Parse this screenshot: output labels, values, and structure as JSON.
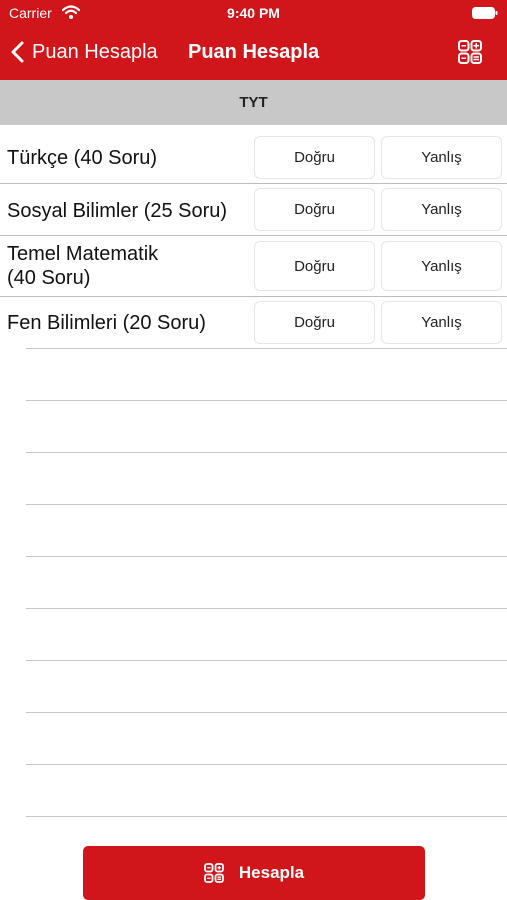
{
  "status_bar": {
    "carrier": "Carrier",
    "time": "9:40 PM",
    "wifi_icon": "wifi-icon",
    "battery_icon": "battery-icon"
  },
  "nav": {
    "back_label": "Puan Hesapla",
    "title": "Puan Hesapla",
    "back_icon": "chevron-left-icon",
    "right_icon": "calculator-grid-icon"
  },
  "section": {
    "title": "TYT"
  },
  "subjects": [
    {
      "label": "Türkçe (40 Soru)",
      "correct_placeholder": "Doğru",
      "wrong_placeholder": "Yanlış"
    },
    {
      "label": "Sosyal Bilimler (25 Soru)",
      "correct_placeholder": "Doğru",
      "wrong_placeholder": "Yanlış"
    },
    {
      "label_line1": "Temel Matematik",
      "label_line2": "(40 Soru)",
      "correct_placeholder": "Doğru",
      "wrong_placeholder": "Yanlış"
    },
    {
      "label": "Fen Bilimleri (20 Soru)",
      "correct_placeholder": "Doğru",
      "wrong_placeholder": "Yanlış"
    }
  ],
  "calculate_button": {
    "label": "Hesapla",
    "icon": "calculator-grid-icon"
  },
  "colors": {
    "accent": "#d0161b",
    "section_background": "#c8c8c8"
  }
}
